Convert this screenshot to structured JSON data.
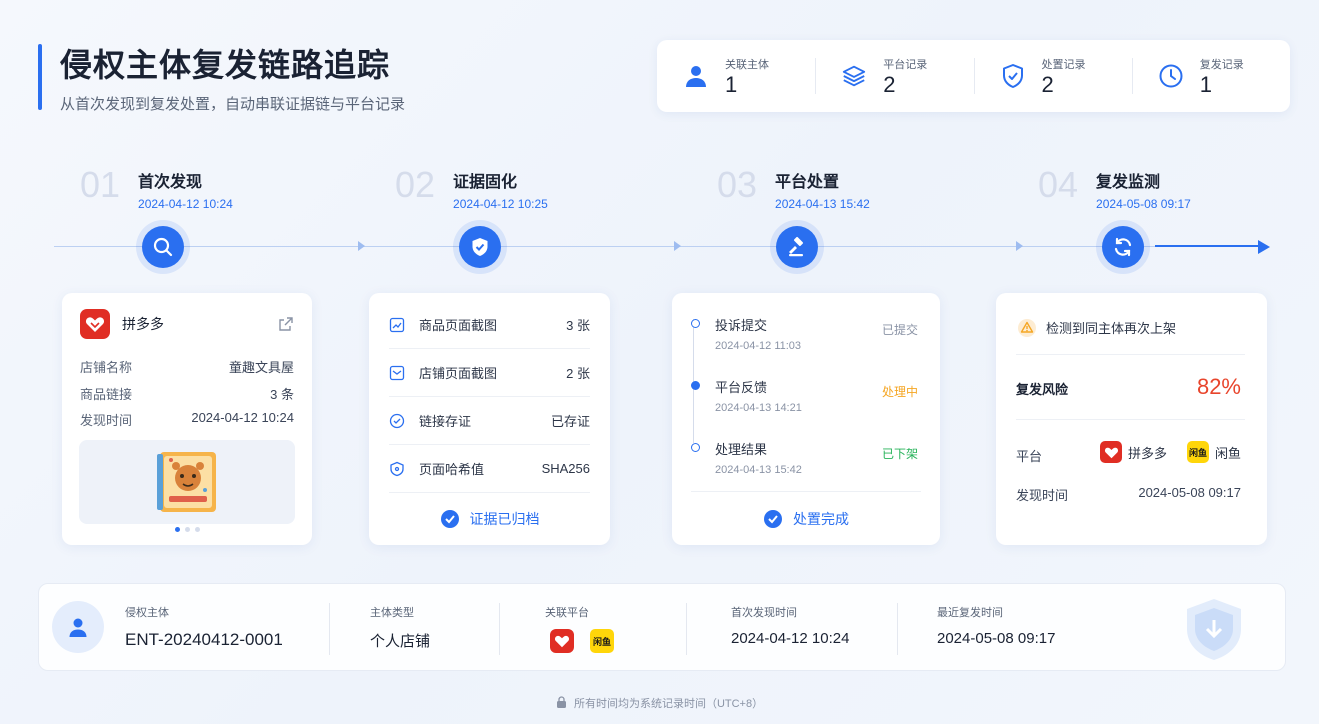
{
  "header": {
    "title": "侵权主体复发链路追踪",
    "subtitle": "从首次发现到复发处置，自动串联证据链与平台记录"
  },
  "stats": [
    {
      "label": "关联主体",
      "value": "1",
      "icon": "user-icon"
    },
    {
      "label": "平台记录",
      "value": "2",
      "icon": "layers-icon"
    },
    {
      "label": "处置记录",
      "value": "2",
      "icon": "shield-icon"
    },
    {
      "label": "复发记录",
      "value": "1",
      "icon": "clock-icon"
    }
  ],
  "steps": [
    {
      "num": "01",
      "title": "首次发现",
      "date": "2024-04-12 10:24",
      "icon": "search-icon"
    },
    {
      "num": "02",
      "title": "证据固化",
      "date": "2024-04-12 10:25",
      "icon": "shield-check-icon"
    },
    {
      "num": "03",
      "title": "平台处置",
      "date": "2024-04-13 15:42",
      "icon": "gavel-icon"
    },
    {
      "num": "04",
      "title": "复发监测",
      "date": "2024-05-08 09:17",
      "icon": "refresh-icon"
    }
  ],
  "card1": {
    "platform": "拼多多",
    "rows": [
      {
        "label": "店铺名称",
        "value": "童趣文具屋"
      },
      {
        "label": "商品链接",
        "value": "3 条"
      },
      {
        "label": "发现时间",
        "value": "2024-04-12 10:24"
      }
    ]
  },
  "card2": {
    "rows": [
      {
        "label": "商品页面截图",
        "value": "3 张"
      },
      {
        "label": "店铺页面截图",
        "value": "2 张"
      },
      {
        "label": "链接存证",
        "value": "已存证"
      },
      {
        "label": "页面哈希值",
        "value": "SHA256"
      }
    ],
    "footer": "证据已归档"
  },
  "card3": {
    "items": [
      {
        "title": "投诉提交",
        "date": "2024-04-12 11:03",
        "status": "已提交",
        "color": "#8a93a5"
      },
      {
        "title": "平台反馈",
        "date": "2024-04-13 14:21",
        "status": "处理中",
        "color": "#f5a623"
      },
      {
        "title": "处理结果",
        "date": "2024-04-13 15:42",
        "status": "已下架",
        "color": "#27b35a"
      }
    ],
    "footer": "处置完成"
  },
  "card4": {
    "alert": "检测到同主体再次上架",
    "risk_label": "复发风险",
    "risk_value": "82%",
    "platform_label": "平台",
    "platforms": [
      "拼多多",
      "闲鱼"
    ],
    "xianyu_logo_text": "闲鱼",
    "time_label": "发现时间",
    "time_value": "2024-05-08 09:17"
  },
  "bottom": {
    "entity_label": "侵权主体",
    "entity_value": "ENT-20240412-0001",
    "type_label": "主体类型",
    "type_value": "个人店铺",
    "platforms_label": "关联平台",
    "first_label": "首次发现时间",
    "first_value": "2024-04-12 10:24",
    "last_label": "最近复发时间",
    "last_value": "2024-05-08 09:17"
  },
  "footer_note": "所有时间均为系统记录时间（UTC+8）",
  "colors": {
    "accent": "#2a6ff0",
    "risk": "#e8452c",
    "pdd": "#e02e24",
    "xianyu": "#ffd60a"
  }
}
